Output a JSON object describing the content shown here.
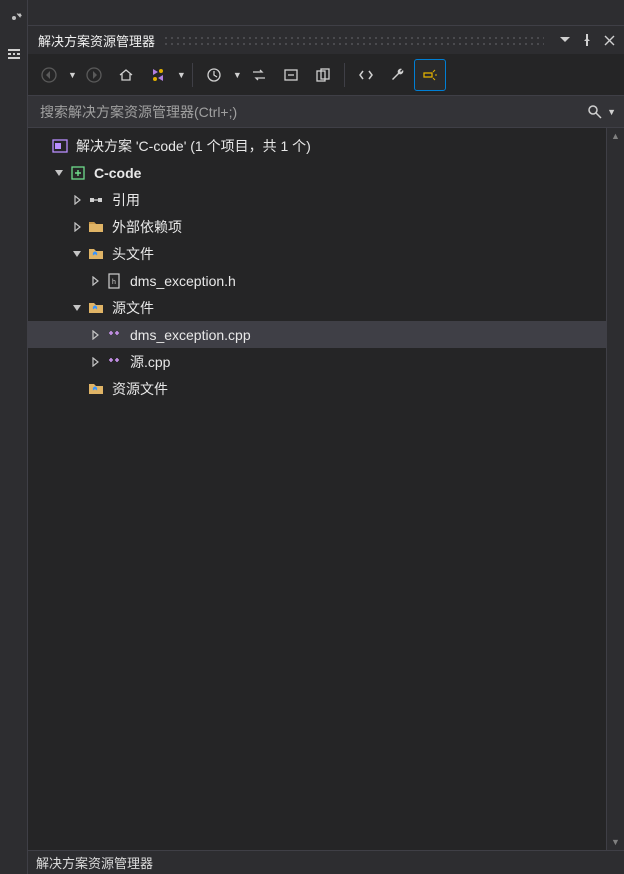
{
  "panel_title": "解决方案资源管理器",
  "search_placeholder": "搜索解决方案资源管理器(Ctrl+;)",
  "footer_text": "解决方案资源管理器",
  "tree": [
    {
      "depth": 0,
      "twisty": "none",
      "icon": "solution",
      "label": "解决方案 'C-code' (1 个项目，共 1 个)",
      "selected": false,
      "bold": false,
      "name": "solution-node"
    },
    {
      "depth": 1,
      "twisty": "expanded",
      "icon": "project",
      "label": "C-code",
      "selected": false,
      "bold": true,
      "name": "project-node"
    },
    {
      "depth": 2,
      "twisty": "collapsed",
      "icon": "references",
      "label": "引用",
      "selected": false,
      "bold": false,
      "name": "references-node"
    },
    {
      "depth": 2,
      "twisty": "collapsed",
      "icon": "external",
      "label": "外部依赖项",
      "selected": false,
      "bold": false,
      "name": "external-deps-node"
    },
    {
      "depth": 2,
      "twisty": "expanded",
      "icon": "folder",
      "label": "头文件",
      "selected": false,
      "bold": false,
      "name": "headers-folder"
    },
    {
      "depth": 3,
      "twisty": "collapsed",
      "icon": "header",
      "label": "dms_exception.h",
      "selected": false,
      "bold": false,
      "name": "file-dms-exception-h"
    },
    {
      "depth": 2,
      "twisty": "expanded",
      "icon": "folder",
      "label": "源文件",
      "selected": false,
      "bold": false,
      "name": "sources-folder"
    },
    {
      "depth": 3,
      "twisty": "collapsed",
      "icon": "cpp",
      "label": "dms_exception.cpp",
      "selected": true,
      "bold": false,
      "name": "file-dms-exception-cpp"
    },
    {
      "depth": 3,
      "twisty": "collapsed",
      "icon": "cpp",
      "label": "源.cpp",
      "selected": false,
      "bold": false,
      "name": "file-yuan-cpp"
    },
    {
      "depth": 2,
      "twisty": "none",
      "icon": "folder",
      "label": "资源文件",
      "selected": false,
      "bold": false,
      "name": "resources-folder"
    }
  ]
}
